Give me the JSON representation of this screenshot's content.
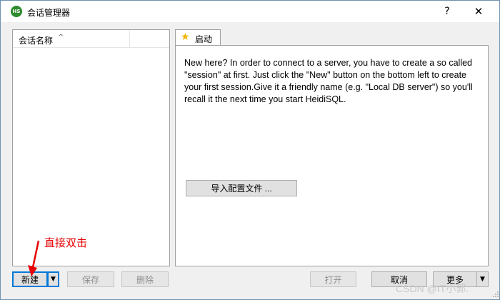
{
  "window": {
    "title": "会话管理器",
    "app_badge": "HS",
    "help": "?",
    "close": "✕"
  },
  "sessions": {
    "column_header": "会话名称",
    "sort_indicator": "^"
  },
  "tab": {
    "label": "启动",
    "icon": "star-icon"
  },
  "intro_text": "New here? In order to connect to a server, you have to create a so called \"session\" at first. Just click the \"New\" button on the bottom left to create your first session.Give it a friendly name (e.g. \"Local DB server\") so you'll recall it the next time you start HeidiSQL.",
  "import_button": "导入配置文件 ...",
  "buttons": {
    "new": "新建",
    "save": "保存",
    "delete": "删除",
    "open": "打开",
    "cancel": "取消",
    "more": "更多"
  },
  "annotation": "直接双击",
  "watermark": "CSDN @IT小郭.",
  "colors": {
    "accent": "#0078d7",
    "annotation": "#e60000",
    "star": "#f2b400"
  }
}
